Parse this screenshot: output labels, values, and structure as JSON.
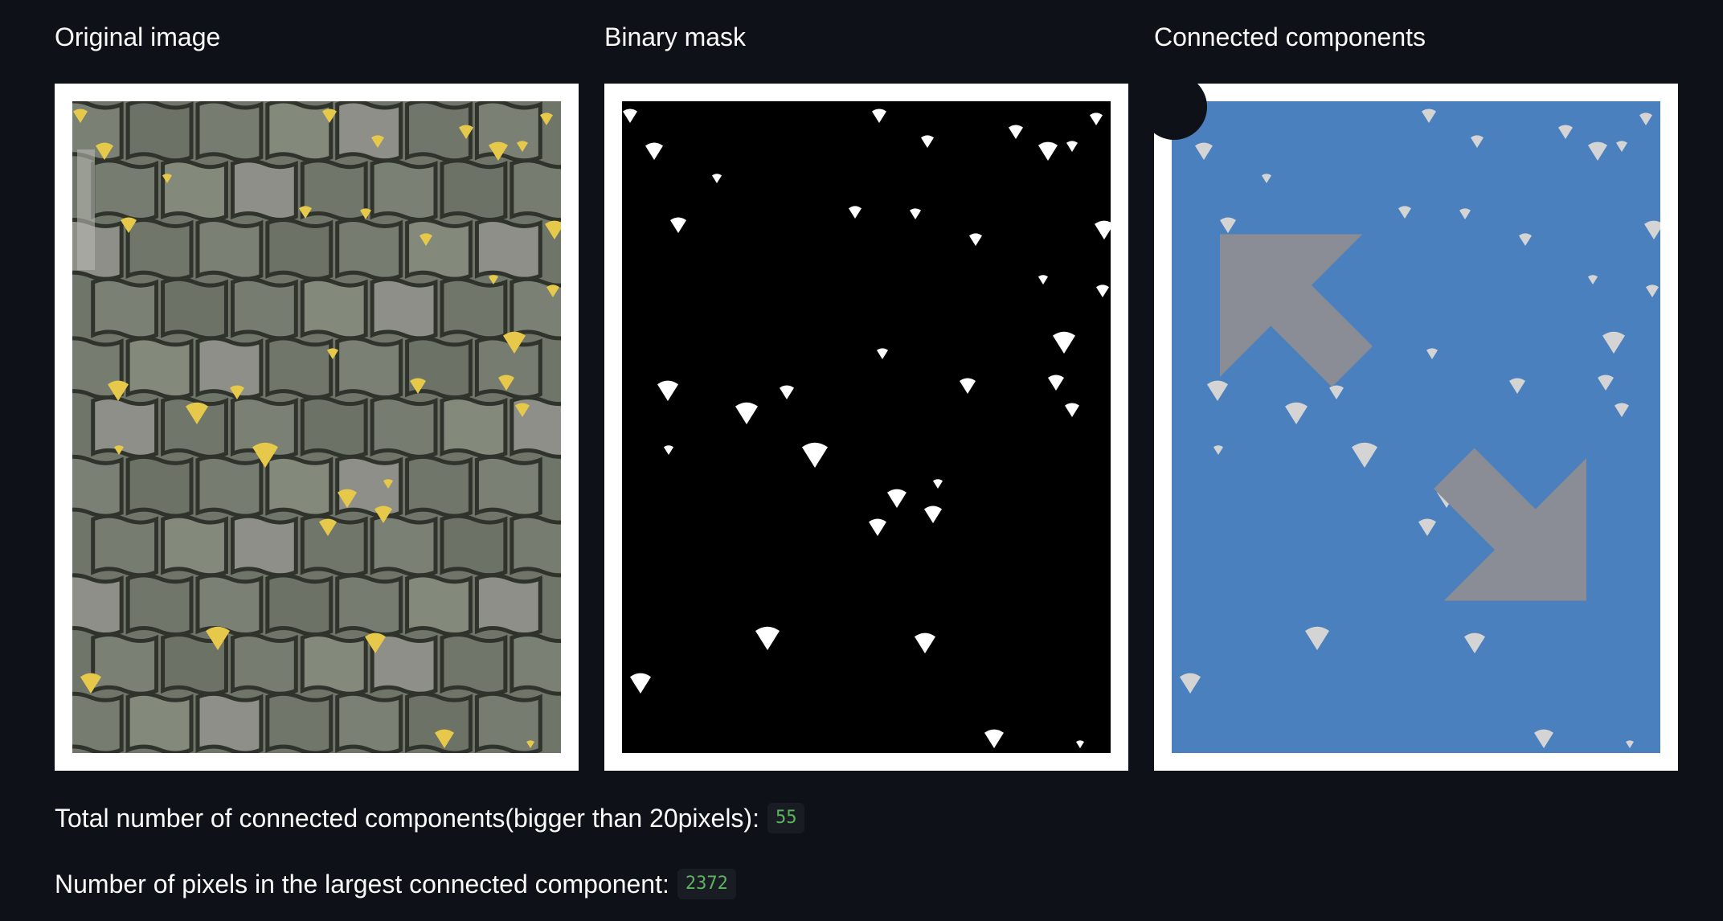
{
  "columns": {
    "original": {
      "title": "Original image"
    },
    "mask": {
      "title": "Binary mask"
    },
    "components": {
      "title": "Connected components",
      "expand_icon": "fullscreen-expand-icon"
    }
  },
  "stats": {
    "total_label": "Total number of connected components(bigger than 20pixels):",
    "total_value": "55",
    "largest_label": "Number of pixels in the largest connected component:",
    "largest_value": "2372"
  },
  "colors": {
    "page_bg": "#0e1117",
    "frame": "#ffffff",
    "pavement": "#6f7569",
    "leaf_yellow": "#e6c84a",
    "mask_bg": "#000000",
    "mask_fg": "#ffffff",
    "components_bg": "#4a80bd",
    "components_fg": "#d4d4d4",
    "code_text": "#5ab55e"
  }
}
